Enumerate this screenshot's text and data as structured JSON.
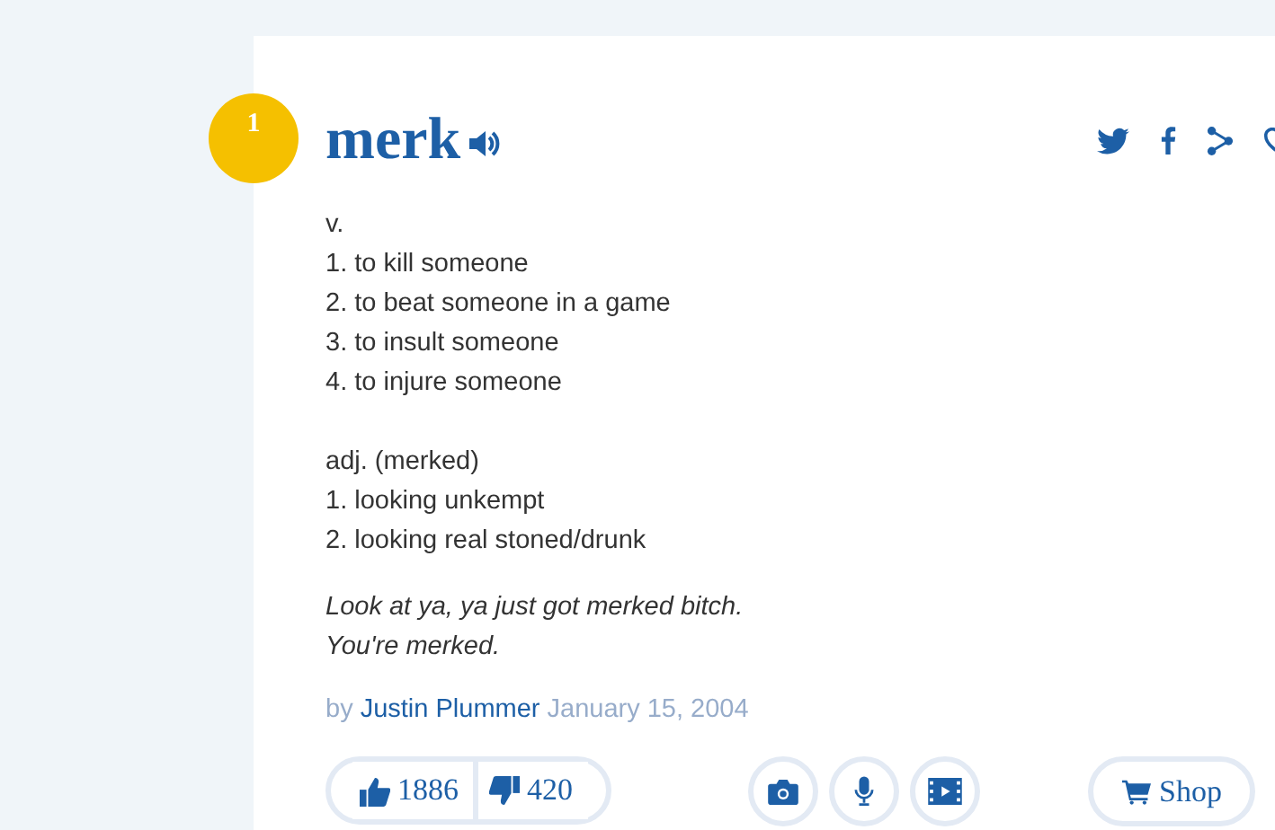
{
  "entry": {
    "rank": "1",
    "word": "merk",
    "meanings": [
      {
        "lines": [
          "v.",
          "1. to kill someone",
          "2. to beat someone in a game",
          "3. to insult someone",
          "4. to injure someone"
        ]
      },
      {
        "lines": [
          "adj. (merked)",
          "1. looking unkempt",
          "2. looking real stoned/drunk"
        ]
      }
    ],
    "example": [
      "Look at ya, ya just got merked bitch.",
      "You're merked."
    ],
    "by": "by",
    "author": "Justin Plummer",
    "date": "January 15, 2004",
    "upvotes": "1886",
    "downvotes": "420",
    "shop": "Shop"
  }
}
